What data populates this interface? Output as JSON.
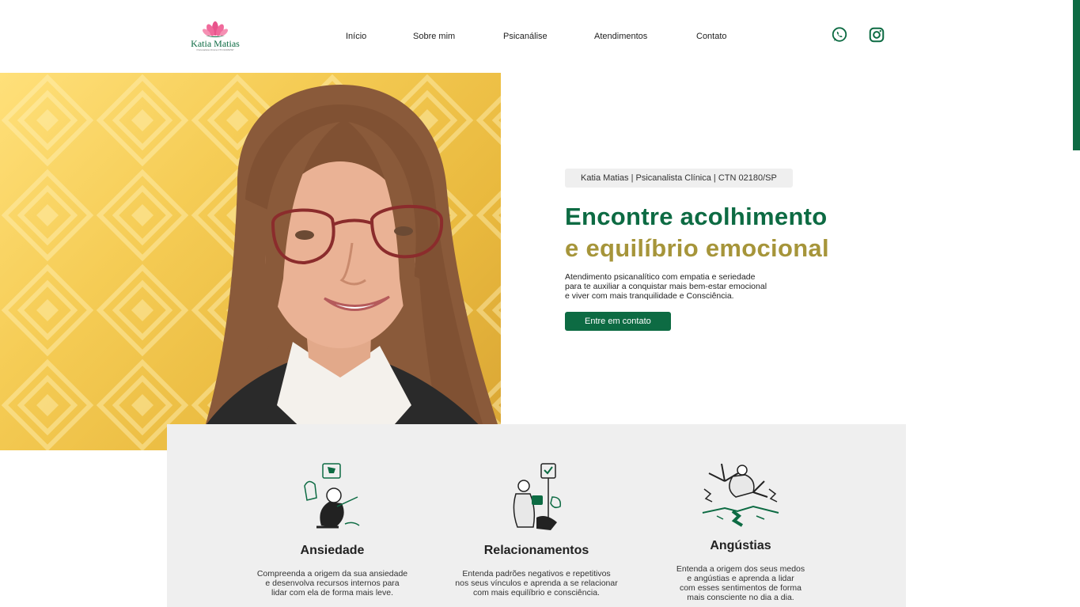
{
  "brand": {
    "name": "Katia Matias",
    "tagline": "Psicanalista Clínica CTN 02180/SP",
    "green": "#0d6b43",
    "gold": "#a6953a"
  },
  "nav": {
    "items": [
      "Início",
      "Sobre mim",
      "Psicanálise",
      "Atendimentos",
      "Contato"
    ]
  },
  "social": {
    "whatsapp_icon": "whatsapp-icon",
    "instagram_icon": "instagram-icon"
  },
  "hero": {
    "badge": "Katia Matias | Psicanalista Clínica | CTN 02180/SP",
    "headline_line1": "Encontre acolhimento",
    "headline_line2": "e equilíbrio emocional",
    "description_lines": [
      "Atendimento psicanalítico com empatia e seriedade",
      "para te auxiliar a conquistar mais bem-estar emocional",
      "e viver com mais tranquilidade e Consciência."
    ],
    "cta_label": "Entre em contato"
  },
  "cards": [
    {
      "title": "Ansiedade",
      "description_lines": [
        "Compreenda a origem da sua ansiedade",
        "e desenvolva recursos internos para",
        "lidar com ela de forma mais leve."
      ]
    },
    {
      "title": "Relacionamentos",
      "description_lines": [
        "Entenda padrões negativos e repetitivos",
        "nos seus vínculos e aprenda a se relacionar",
        "com mais equilíbrio e consciência."
      ]
    },
    {
      "title": "Angústias",
      "description_lines": [
        "Entenda a origem dos seus medos",
        "e angústias e aprenda a lidar",
        "com esses sentimentos de forma",
        "mais consciente no dia a dia."
      ]
    }
  ]
}
